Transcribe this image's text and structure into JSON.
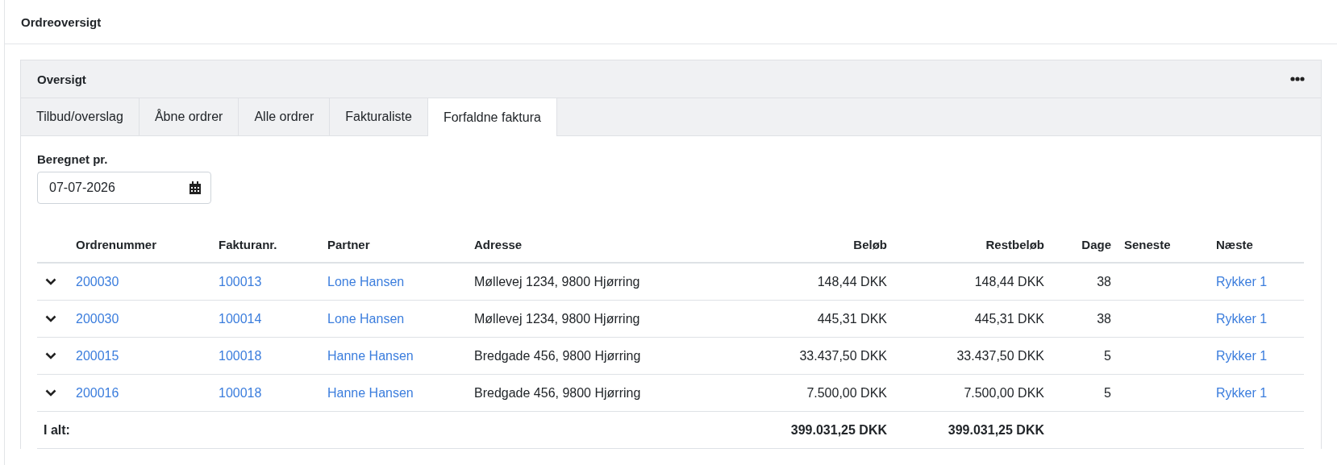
{
  "page": {
    "title": "Ordreoversigt"
  },
  "card": {
    "title": "Oversigt"
  },
  "tabs": [
    {
      "label": "Tilbud/overslag",
      "selected": false
    },
    {
      "label": "Åbne ordrer",
      "selected": false
    },
    {
      "label": "Alle ordrer",
      "selected": false
    },
    {
      "label": "Fakturaliste",
      "selected": false
    },
    {
      "label": "Forfaldne faktura",
      "selected": true
    }
  ],
  "date_field": {
    "label": "Beregnet pr.",
    "value": "07-07-2026"
  },
  "table": {
    "columns": [
      "Ordrenummer",
      "Fakturanr.",
      "Partner",
      "Adresse",
      "Beløb",
      "Restbeløb",
      "Dage",
      "Seneste",
      "Næste"
    ],
    "rows": [
      {
        "expanded": false,
        "order": "200030",
        "invoice": "100013",
        "partner": "Lone Hansen",
        "address": "Møllevej 1234, 9800 Hjørring",
        "amount": "148,44 DKK",
        "remaining": "148,44 DKK",
        "days": "38",
        "next": "Rykker 1"
      },
      {
        "expanded": false,
        "order": "200030",
        "invoice": "100014",
        "partner": "Lone Hansen",
        "address": "Møllevej 1234, 9800 Hjørring",
        "amount": "445,31 DKK",
        "remaining": "445,31 DKK",
        "days": "38",
        "next": "Rykker 1"
      },
      {
        "expanded": false,
        "order": "200015",
        "invoice": "100018",
        "partner": "Hanne Hansen",
        "address": "Bredgade 456, 9800 Hjørring",
        "amount": "33.437,50 DKK",
        "remaining": "33.437,50 DKK",
        "days": "5",
        "next": "Rykker 1"
      },
      {
        "expanded": false,
        "order": "200016",
        "invoice": "100018",
        "partner": "Hanne Hansen",
        "address": "Bredgade 456, 9800 Hjørring",
        "amount": "7.500,00 DKK",
        "remaining": "7.500,00 DKK",
        "days": "5",
        "next": "Rykker 1"
      }
    ],
    "total": {
      "label": "I alt:",
      "amount": "399.031,25 DKK",
      "remaining": "399.031,25 DKK"
    }
  }
}
